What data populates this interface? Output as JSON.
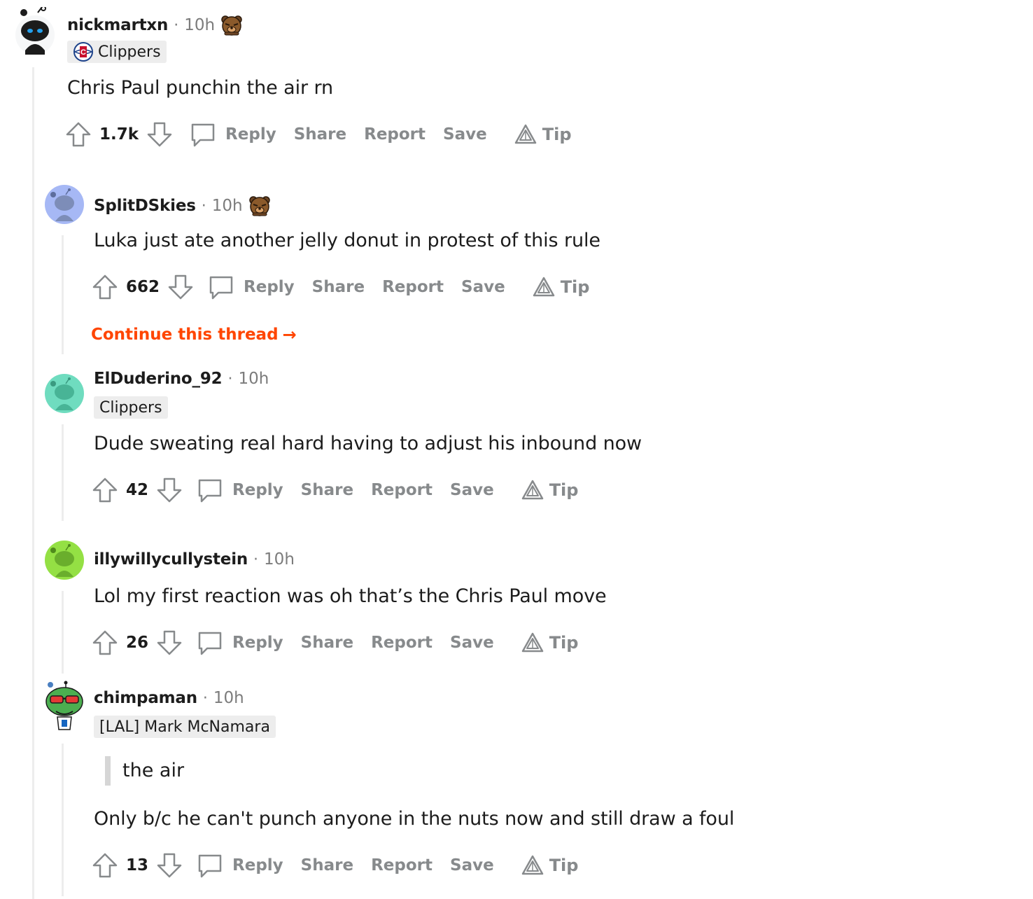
{
  "colors": {
    "accent": "#ff4500",
    "muted": "#878a8c",
    "thread_line": "#ededed",
    "flair_bg": "#ededed"
  },
  "labels": {
    "reply": "Reply",
    "share": "Share",
    "report": "Report",
    "save": "Save",
    "tip": "Tip",
    "continue_thread": "Continue this thread",
    "dot": "·"
  },
  "comments": [
    {
      "username": "nickmartxn",
      "time": "10h",
      "award": "bear-award-icon",
      "flair": "Clippers",
      "flair_logo": "clippers-logo-icon",
      "body": "Chris Paul punchin the air rn",
      "score": "1.7k",
      "avatar": "snoo-black-avatar"
    },
    {
      "username": "SplitDSkies",
      "time": "10h",
      "award": "bear-award-icon",
      "body": "Luka just ate another jelly donut in protest of this rule",
      "score": "662",
      "avatar": "snoo-blue-avatar"
    },
    {
      "username": "ElDuderino_92",
      "time": "10h",
      "flair": "Clippers",
      "body": "Dude sweating real hard having to adjust his inbound now",
      "score": "42",
      "avatar": "snoo-teal-avatar"
    },
    {
      "username": "illywillycullystein",
      "time": "10h",
      "body": "Lol my first reaction was oh that’s the Chris Paul move",
      "score": "26",
      "avatar": "snoo-green-avatar"
    },
    {
      "username": "chimpaman",
      "time": "10h",
      "flair": "[LAL] Mark McNamara",
      "quote": "the air",
      "body": "Only b/c he can't punch anyone in the nuts now and still draw a foul",
      "score": "13",
      "avatar": "snoo-sunglasses-avatar"
    }
  ]
}
